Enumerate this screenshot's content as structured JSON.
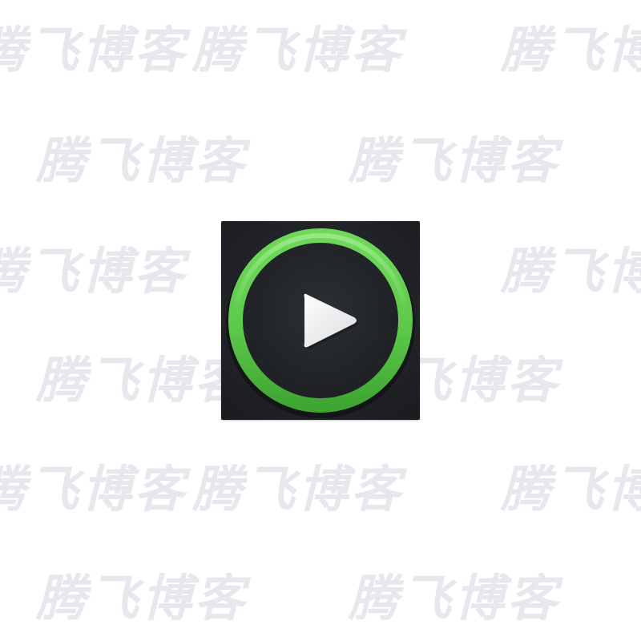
{
  "watermark": {
    "text": "腾飞博客"
  },
  "app_icon": {
    "icon": "play-icon",
    "ring_color": "#5cc94a",
    "background_color": "#1f2125",
    "play_color": "#ffffff"
  }
}
